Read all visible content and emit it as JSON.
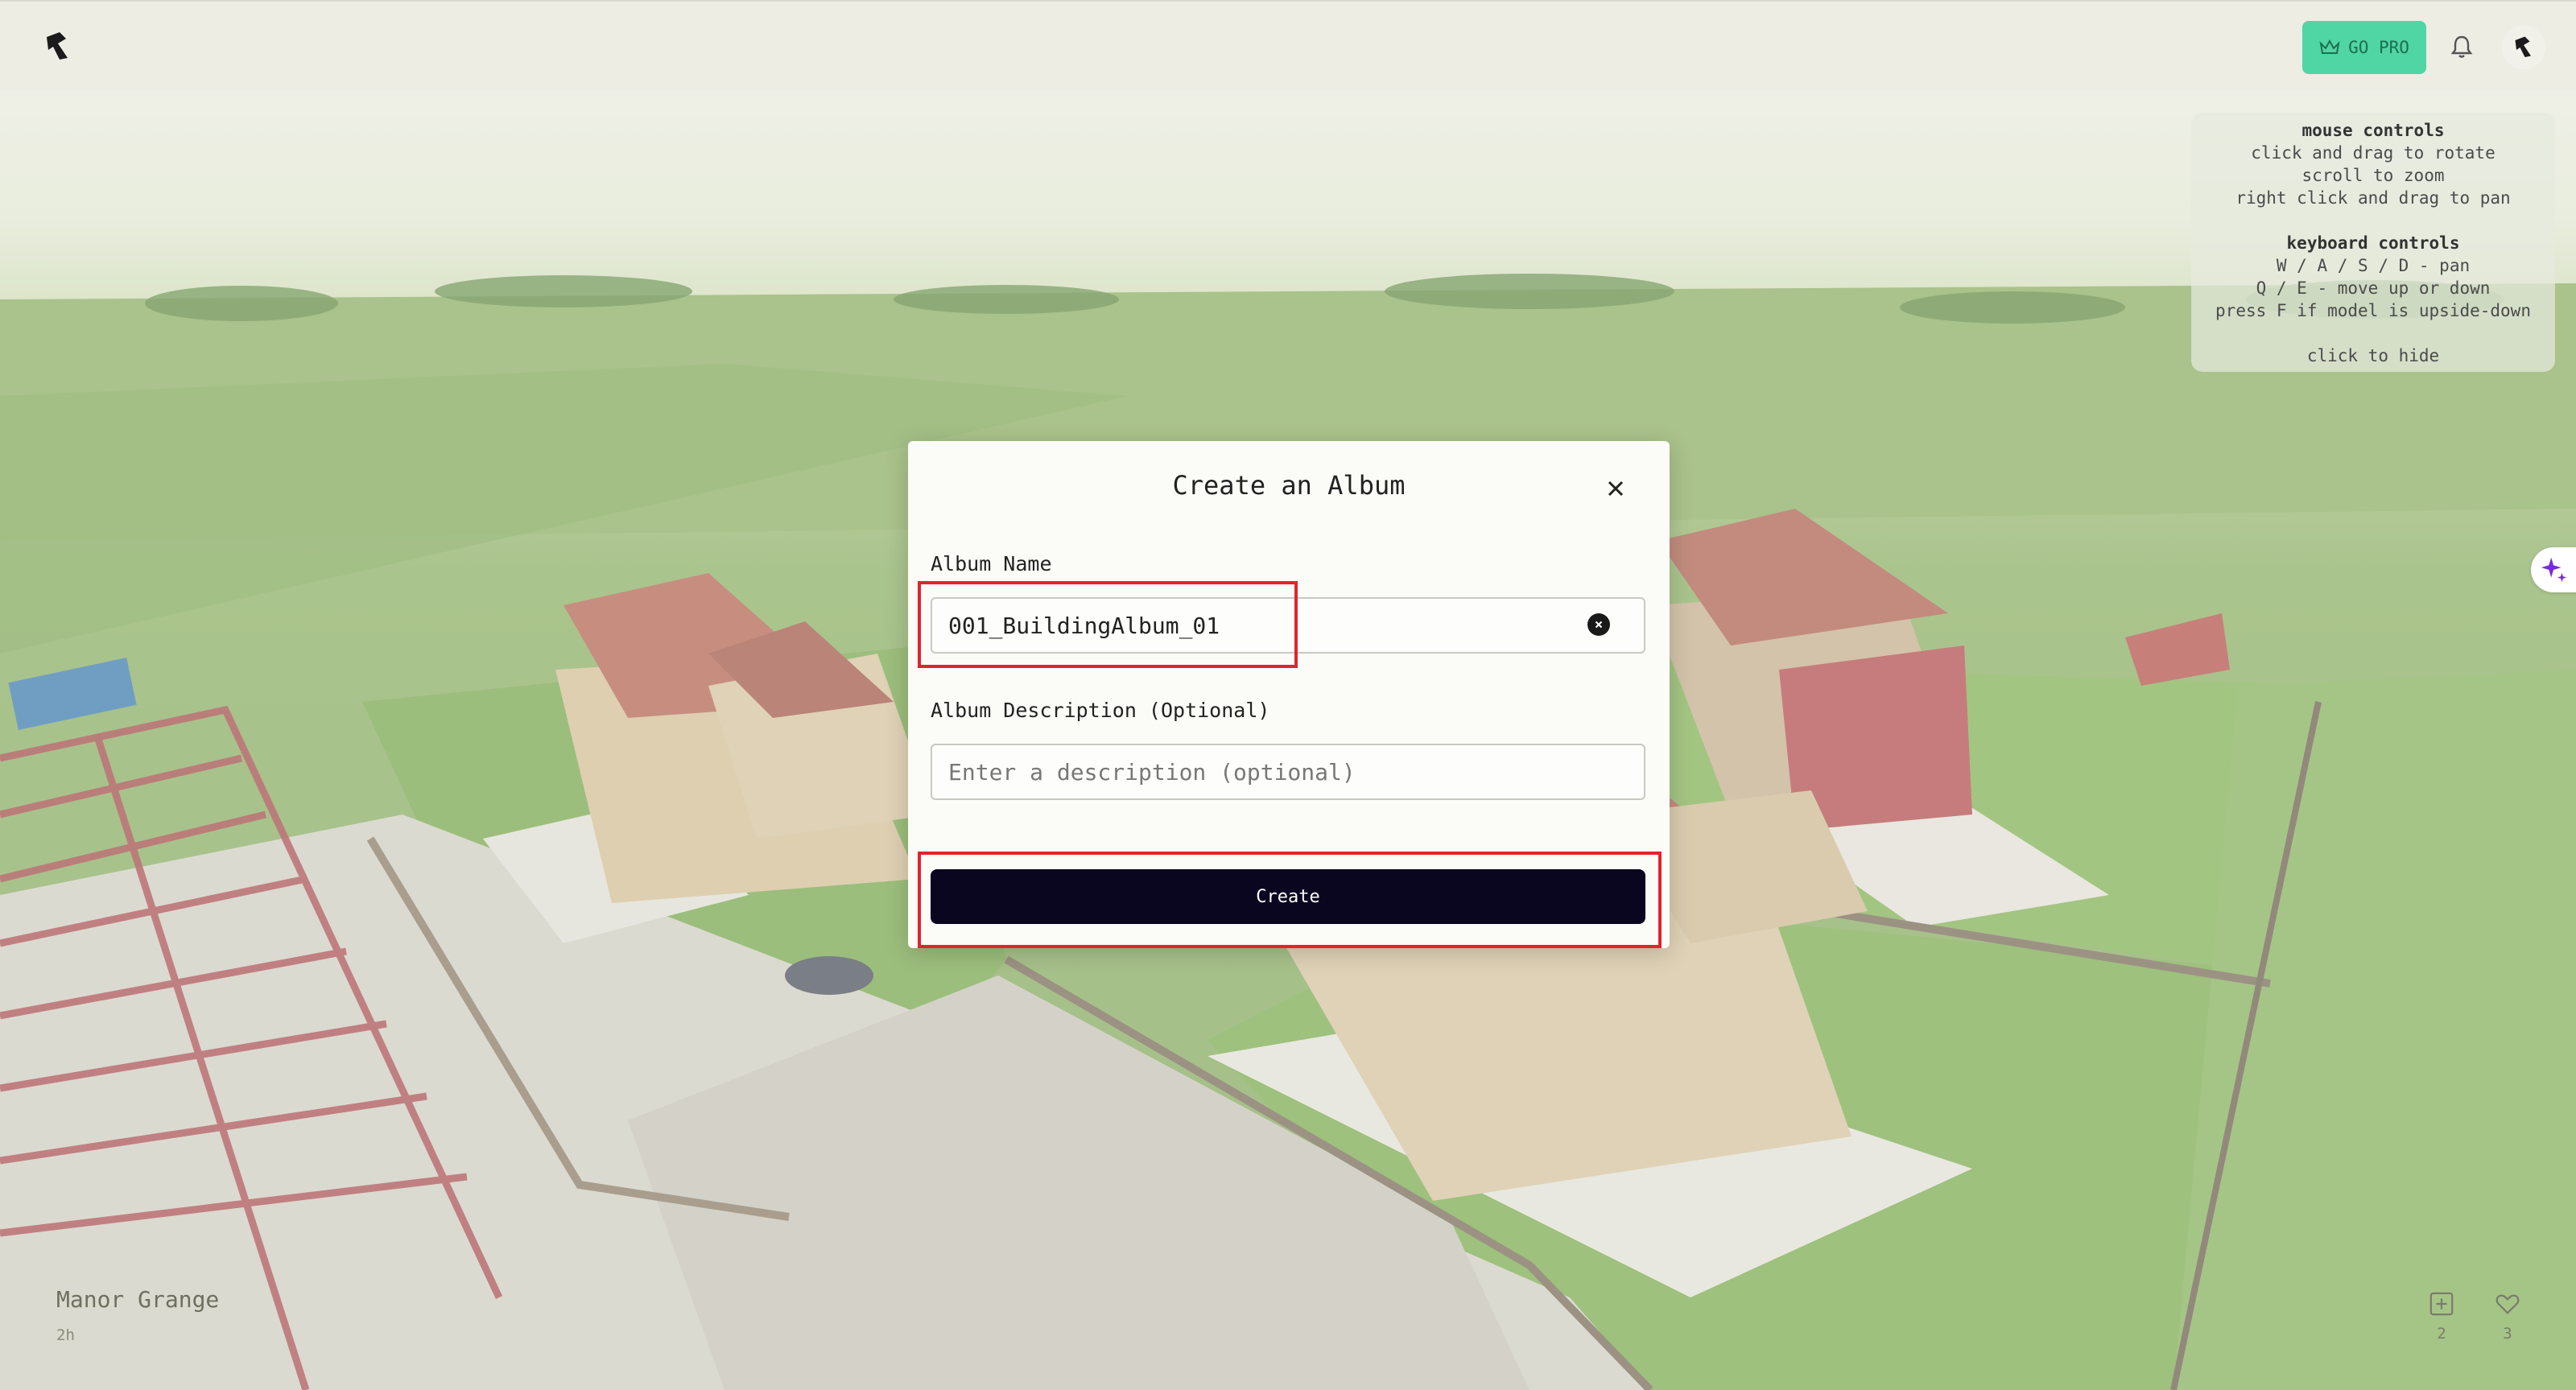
{
  "header": {
    "go_pro_label": "GO PRO",
    "accent": "#4fd6a4"
  },
  "help_panel": {
    "mouse_title": "mouse controls",
    "mouse_lines": [
      "click and drag to rotate",
      "scroll to zoom",
      "right click and drag to pan"
    ],
    "keyboard_title": "keyboard controls",
    "keyboard_lines": [
      "W / A / S / D - pan",
      "Q / E - move up or down",
      "press F if model is upside-down"
    ],
    "hide_hint": "click to hide"
  },
  "scene": {
    "title": "Manor Grange",
    "age": "2h",
    "add_count": "2",
    "like_count": "3"
  },
  "modal": {
    "title": "Create an Album",
    "name_label": "Album Name",
    "name_value": "001_BuildingAlbum_01",
    "description_label": "Album Description (Optional)",
    "description_placeholder": "Enter a description (optional)",
    "description_value": "",
    "create_label": "Create",
    "highlight_color": "#e0242c"
  }
}
